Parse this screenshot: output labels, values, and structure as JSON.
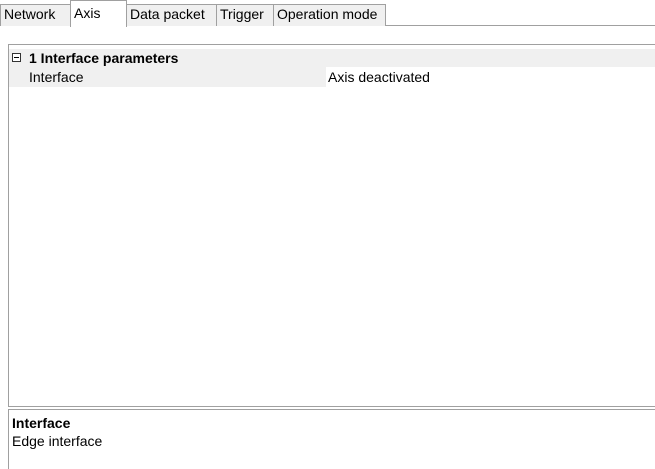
{
  "tabs": [
    {
      "label": "Network"
    },
    {
      "label": "Axis"
    },
    {
      "label": "Data packet"
    },
    {
      "label": "Trigger"
    },
    {
      "label": "Operation mode"
    }
  ],
  "active_tab": "Axis",
  "property_grid": {
    "category": {
      "label": "1 Interface parameters",
      "expanded": true
    },
    "properties": [
      {
        "name": "Interface",
        "value": "Axis deactivated"
      }
    ]
  },
  "description": {
    "title": "Interface",
    "text": "Edge interface"
  },
  "colors": {
    "border": "#a0a0a0",
    "category_background": "#f0f0f0",
    "background": "#ffffff"
  }
}
